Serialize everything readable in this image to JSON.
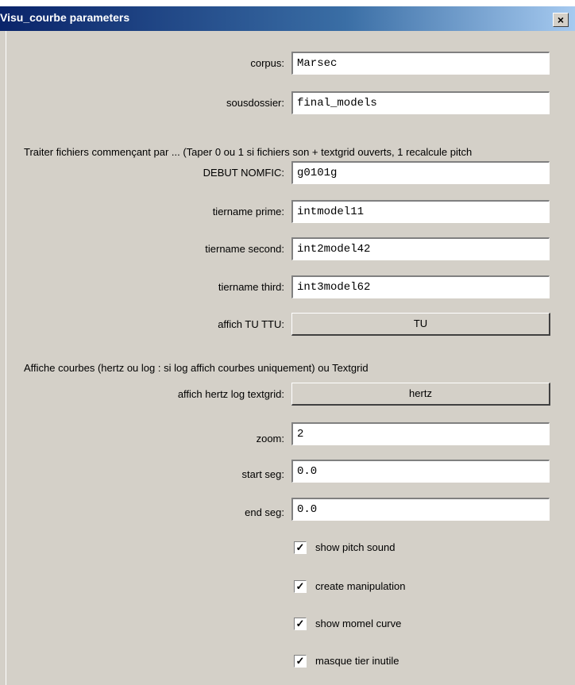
{
  "window": {
    "title": "Visu_courbe parameters",
    "close_label": "×"
  },
  "fields": {
    "corpus": {
      "label": "corpus:",
      "value": "Marsec"
    },
    "sousdossier": {
      "label": "sousdossier:",
      "value": "final_models"
    },
    "debut_nomfic": {
      "label": "DEBUT NOMFIC:",
      "value": "g0101g"
    },
    "tiername_prime": {
      "label": "tiername prime:",
      "value": "intmodel11"
    },
    "tiername_second": {
      "label": "tiername second:",
      "value": "int2model42"
    },
    "tiername_third": {
      "label": "tiername third:",
      "value": "int3model62"
    },
    "zoom": {
      "label": "zoom:",
      "value": "2"
    },
    "start_seg": {
      "label": "start seg:",
      "value": "0.0"
    },
    "end_seg": {
      "label": "end seg:",
      "value": "0.0"
    }
  },
  "section1": "Traiter fichiers commençant par ... (Taper 0 ou 1 si fichiers son + textgrid ouverts, 1 recalcule pitch",
  "section2": "Affiche courbes (hertz ou log : si log affich courbes uniquement) ou Textgrid",
  "options": {
    "affich_tu_ttu": {
      "label": "affich TU TTU:",
      "value": "TU"
    },
    "affich_hertz": {
      "label": "affich hertz log textgrid:",
      "value": "hertz"
    }
  },
  "checkboxes": [
    {
      "label": "show pitch sound",
      "checked": true
    },
    {
      "label": "create manipulation",
      "checked": true
    },
    {
      "label": "show momel curve",
      "checked": true
    },
    {
      "label": "masque tier inutile",
      "checked": true
    }
  ],
  "check_mark": "✓"
}
